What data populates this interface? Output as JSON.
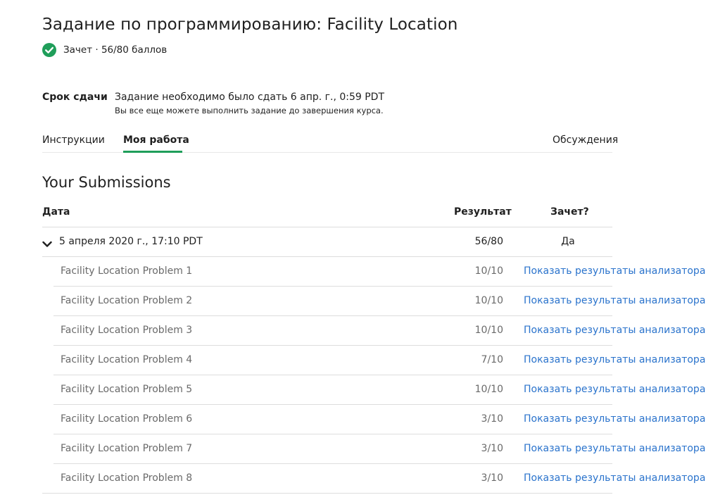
{
  "header": {
    "title": "Задание по программированию: Facility Location",
    "status_text": "Зачет · 56/80 баллов"
  },
  "due": {
    "label": "Срок сдачи",
    "text": "Задание необходимо было сдать 6 апр. г., 0:59 PDT",
    "note": "Вы все еще можете выполнить задание до завершения курса."
  },
  "tabs": [
    {
      "label": "Инструкции",
      "active": false
    },
    {
      "label": "Моя работа",
      "active": true
    },
    {
      "label": "Обсуждения",
      "active": false
    }
  ],
  "submissions": {
    "title": "Your Submissions",
    "columns": {
      "date": "Дата",
      "result": "Результат",
      "passed": "Зачет?"
    },
    "submission": {
      "date": "5 апреля 2020 г., 17:10 PDT",
      "score": "56/80",
      "passed": "Да"
    },
    "parts": [
      {
        "name": "Facility Location Problem 1",
        "score": "10/10",
        "link": "Показать результаты анализатора"
      },
      {
        "name": "Facility Location Problem 2",
        "score": "10/10",
        "link": "Показать результаты анализатора"
      },
      {
        "name": "Facility Location Problem 3",
        "score": "10/10",
        "link": "Показать результаты анализатора"
      },
      {
        "name": "Facility Location Problem 4",
        "score": "7/10",
        "link": "Показать результаты анализатора"
      },
      {
        "name": "Facility Location Problem 5",
        "score": "10/10",
        "link": "Показать результаты анализатора"
      },
      {
        "name": "Facility Location Problem 6",
        "score": "3/10",
        "link": "Показать результаты анализатора"
      },
      {
        "name": "Facility Location Problem 7",
        "score": "3/10",
        "link": "Показать результаты анализатора"
      },
      {
        "name": "Facility Location Problem 8",
        "score": "3/10",
        "link": "Показать результаты анализатора"
      }
    ]
  },
  "colors": {
    "accent": "#1f9e5a",
    "link": "#2a73cc"
  }
}
